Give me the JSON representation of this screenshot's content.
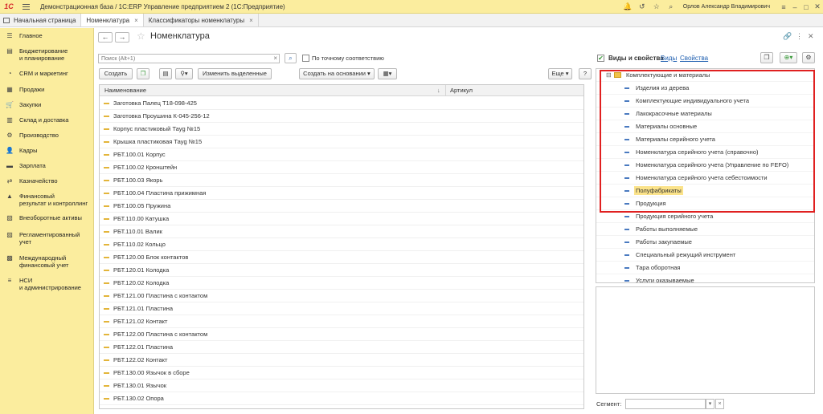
{
  "titlebar": {
    "logo": "1С",
    "title": "Демонстрационная база / 1С:ERP Управление предприятием 2  (1С:Предприятие)",
    "user": "Орлов Александр Владимирович"
  },
  "tabs": [
    {
      "label": "Начальная страница"
    },
    {
      "label": "Номенклатура"
    },
    {
      "label": "Классификаторы номенклатуры"
    }
  ],
  "sidebar": {
    "items": [
      {
        "label": "Главное",
        "icon": "☰"
      },
      {
        "label": "Бюджетирование\nи планирование",
        "icon": "▤"
      },
      {
        "label": "CRM и маркетинг",
        "icon": "◔"
      },
      {
        "label": "Продажи",
        "icon": "▦"
      },
      {
        "label": "Закупки",
        "icon": "🛒"
      },
      {
        "label": "Склад и доставка",
        "icon": "▥"
      },
      {
        "label": "Производство",
        "icon": "⚙"
      },
      {
        "label": "Кадры",
        "icon": "👤"
      },
      {
        "label": "Зарплата",
        "icon": "▬"
      },
      {
        "label": "Казначейство",
        "icon": "⇄"
      },
      {
        "label": "Финансовый\nрезультат и контроллинг",
        "icon": "▲"
      },
      {
        "label": "Внеоборотные активы",
        "icon": "▧"
      },
      {
        "label": "Регламентированный\nучет",
        "icon": "▨"
      },
      {
        "label": "Международный\nфинансовый учет",
        "icon": "▩"
      },
      {
        "label": "НСИ\nи администрирование",
        "icon": "≡"
      }
    ]
  },
  "main": {
    "title": "Номенклатура",
    "search_placeholder": "Поиск (Alt+1)",
    "exact_match_label": "По точному соответствию",
    "buttons": {
      "create": "Создать",
      "edit_selected": "Изменить выделенные",
      "create_based_on": "Создать на основании",
      "more": "Еще",
      "help": "?"
    },
    "columns": {
      "name": "Наименование",
      "article": "Артикул"
    },
    "rows": [
      "Заготовка Палец Т18-098-425",
      "Заготовка Проушина К-045-256-12",
      "Корпус пластиковый Тауg №15",
      "Крышка пластиковая Тауg №15",
      "РБТ.100.01 Корпус",
      "РБТ.100.02 Кронштейн",
      "РБТ.100.03 Якорь",
      "РБТ.100.04 Пластина прижимная",
      "РБТ.100.05 Пружина",
      "РБТ.110.00 Катушка",
      "РБТ.110.01 Валик",
      "РБТ.110.02 Кольцо",
      "РБТ.120.00 Блок контактов",
      "РБТ.120.01 Колодка",
      "РБТ.120.02 Колодка",
      "РБТ.121.00 Пластина с контактом",
      "РБТ.121.01 Пластина",
      "РБТ.121.02 Контакт",
      "РБТ.122.00 Пластина с контактом",
      "РБТ.122.01 Пластина",
      "РБТ.122.02 Контакт",
      "РБТ.130.00 Язычок в сборе",
      "РБТ.130.01 Язычок",
      "РБТ.130.02 Опора"
    ]
  },
  "right_panel": {
    "title": "Виды и свойства",
    "link_kinds": "Виды",
    "link_props": "Свойства",
    "tree_root": "Комплектующие и материалы",
    "tree_items": [
      "Изделия из дерева",
      "Комплектующие индивидуального учета",
      "Лакокрасочные материалы",
      "Материалы основные",
      "Материалы серийного учета",
      "Номенклатура серийного учета (справочно)",
      "Номенклатура серийного учета (Управление по FEFO)",
      "Номенклатура серийного учета себестоимости",
      "Полуфабрикаты",
      "Продукция",
      "Продукция серийного учета",
      "Работы выполняемые",
      "Работы закупаемые",
      "Специальный режущий инструмент",
      "Тара оборотная",
      "Услуги оказываемые"
    ],
    "highlighted_item": "Полуфабрикаты",
    "segment_label": "Сегмент:"
  }
}
